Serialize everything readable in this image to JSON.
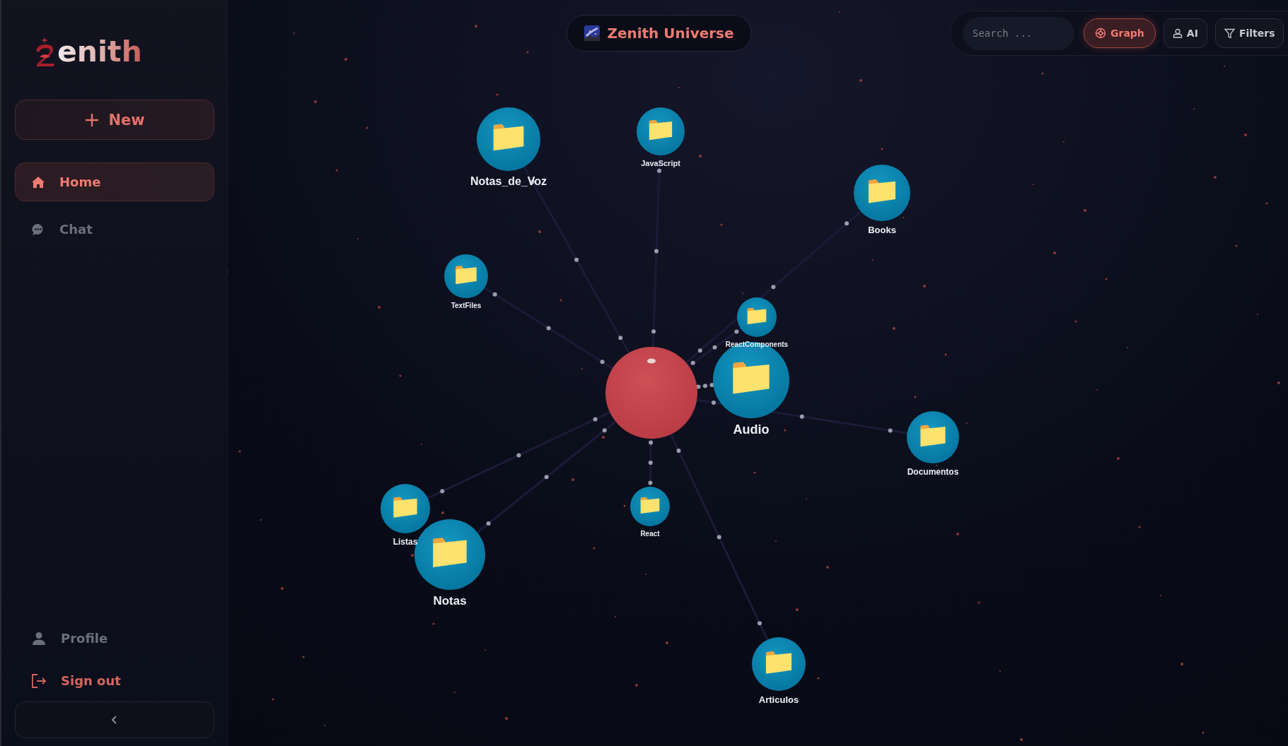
{
  "logo": {
    "text": "enith"
  },
  "new_button": {
    "label": "New"
  },
  "nav": [
    {
      "label": "Home",
      "kind": "home",
      "selected": true
    },
    {
      "label": "Chat",
      "kind": "chat",
      "selected": false
    }
  ],
  "bottom_nav": [
    {
      "label": "Profile",
      "kind": "profile"
    },
    {
      "label": "Sign out",
      "kind": "signout"
    }
  ],
  "header": {
    "title": "Zenith Universe"
  },
  "toolbar": {
    "search": {
      "placeholder": "Search ..."
    },
    "buttons": [
      {
        "label": "Graph",
        "kind": "graph",
        "selected": true
      },
      {
        "label": "AI",
        "kind": "ai",
        "selected": false
      },
      {
        "label": "Filters",
        "kind": "filter",
        "selected": false
      }
    ]
  },
  "graph": {
    "nodes": [
      {
        "label": "Notas_de_Voz"
      },
      {
        "label": "JavaScript"
      },
      {
        "label": "Books"
      },
      {
        "label": "TextFiles"
      },
      {
        "label": "ReactComponents"
      },
      {
        "label": "Audio"
      },
      {
        "label": "Documentos"
      },
      {
        "label": "Listas"
      },
      {
        "label": "Notas"
      },
      {
        "label": "React"
      },
      {
        "label": "Articulos"
      }
    ]
  }
}
